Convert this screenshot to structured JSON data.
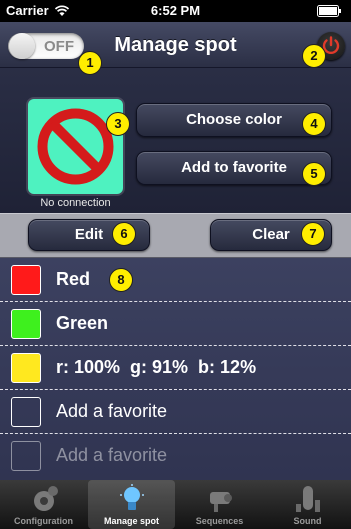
{
  "status_bar": {
    "carrier": "Carrier",
    "time": "6:52 PM"
  },
  "header": {
    "switch_label": "OFF",
    "title": "Manage spot"
  },
  "spot": {
    "status": "No connection",
    "color": "#4ef2c0"
  },
  "actions": {
    "choose_color": "Choose color",
    "add_favorite": "Add to favorite"
  },
  "edit_bar": {
    "edit": "Edit",
    "clear": "Clear"
  },
  "favorites": [
    {
      "label": "Red",
      "color": "#ff1a1a"
    },
    {
      "label": "Green",
      "color": "#3ef01e"
    },
    {
      "label": "r: 100%  g: 91%  b: 12%",
      "color": "#ffe81f"
    },
    {
      "label": "Add a favorite",
      "color": ""
    },
    {
      "label": "Add a favorite",
      "color": ""
    }
  ],
  "tabs": [
    {
      "label": "Configuration",
      "icon": "gear-icon",
      "active": false
    },
    {
      "label": "Manage spot",
      "icon": "lightbulb-icon",
      "active": true
    },
    {
      "label": "Sequences",
      "icon": "projector-icon",
      "active": false
    },
    {
      "label": "Sound",
      "icon": "mixer-icon",
      "active": false
    }
  ],
  "callouts": [
    "1",
    "2",
    "3",
    "4",
    "5",
    "6",
    "7",
    "8"
  ]
}
